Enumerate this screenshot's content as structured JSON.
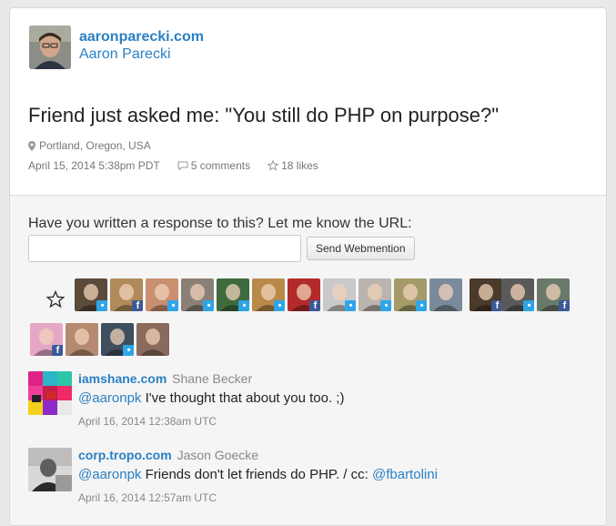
{
  "author": {
    "site": "aaronparecki.com",
    "name": "Aaron Parecki",
    "photo_icon": "author-photo"
  },
  "post": {
    "text": "Friend just asked me: \"You still do PHP on purpose?\"",
    "location": "Portland, Oregon, USA",
    "date": "April 15, 2014 5:38pm PDT",
    "comments": "5 comments",
    "likes": "18 likes",
    "icons": {
      "location": "map-pin-icon",
      "comments": "speech-bubble-icon",
      "likes": "star-icon"
    }
  },
  "webmention": {
    "prompt": "Have you written a response to this? Let me know the URL:",
    "placeholder": "",
    "button_label": "Send Webmention"
  },
  "likes": {
    "icon": "star-icon",
    "avatars": [
      {
        "source": "twitter",
        "color": "#5b4a3a"
      },
      {
        "source": "facebook",
        "color": "#b08a5a"
      },
      {
        "source": "twitter",
        "color": "#c98f6f"
      },
      {
        "source": "twitter",
        "color": "#8a8078"
      },
      {
        "source": "twitter",
        "color": "#3e6a3e"
      },
      {
        "source": "twitter",
        "color": "#b88a4a"
      },
      {
        "source": "facebook",
        "color": "#b42a2a"
      },
      {
        "source": "twitter",
        "color": "#c9c9c9"
      },
      {
        "source": "twitter",
        "color": "#b9b4ae"
      },
      {
        "source": "twitter",
        "color": "#a49a6a"
      },
      {
        "source": "none",
        "color": "#7a8a9a"
      },
      {
        "source": "facebook",
        "color": "#4a3a2a"
      },
      {
        "source": "twitter",
        "color": "#5a5a5a"
      },
      {
        "source": "facebook",
        "color": "#6a7a6a"
      },
      {
        "source": "facebook",
        "color": "#e6a7c7"
      },
      {
        "source": "none",
        "color": "#b58a70"
      },
      {
        "source": "twitter",
        "color": "#3e4e5e"
      },
      {
        "source": "none",
        "color": "#8a6a5a"
      }
    ]
  },
  "comments": [
    {
      "site": "iamshane.com",
      "name": "Shane Becker",
      "mention": "@aaronpk",
      "text": " I've thought that about you too. ;)",
      "date": "April 16, 2014 12:38am UTC",
      "photo_icon": "color-blocks-avatar"
    },
    {
      "site": "corp.tropo.com",
      "name": "Jason Goecke",
      "mention": "@aaronpk",
      "text": " Friends don't let friends do PHP. / cc: ",
      "mention2": "@fbartolini",
      "date": "April 16, 2014 12:57am UTC",
      "photo_icon": "person-avatar"
    }
  ]
}
